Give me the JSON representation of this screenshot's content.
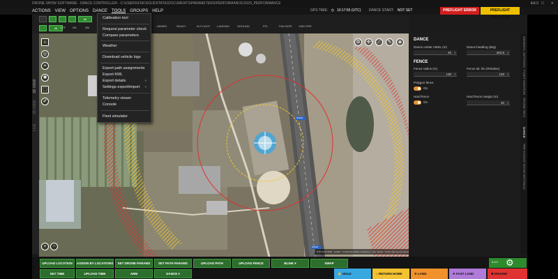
{
  "titlebar": {
    "text": "DRONE SHOW SOFTWARE   -   DANCE CONTROLLER   -   C:\\USERS\\FSK\\SOLIDSTATE\\DOCUMENTS\\PARAMETERS\\PERFORMANCE\\2020_PERFORMANCE",
    "version": "6.6.0",
    "window_controls": "—  ☐  ✕"
  },
  "menubar": {
    "items": [
      "ACTIONS",
      "VIEW",
      "OPTIONS",
      "DANCE",
      "TOOLS",
      "GROUPS",
      "HELP"
    ],
    "gps_time_label": "GPS TIME:",
    "gps_time_value": "10:17:55 (UTC)",
    "dance_start_label": "DANCE START:",
    "dance_start_value": "NOT SET",
    "preflight_error": "PREFLIGHT ERROR",
    "preflight_checklist": "PREFLIGHT CHECKLIST"
  },
  "toolbar": {
    "btn_all": "All",
    "btn_all2": "All",
    "btn_46": "46",
    "labels": [
      "OFF",
      "OK",
      "ON"
    ],
    "stat_headers": [
      "ARMED",
      "READY",
      "IN FLIGHT",
      "LANDING",
      "GROUND",
      "RTL",
      "FAILSAFE",
      "CMD ERR"
    ]
  },
  "left_tabs": [
    "3D VIEW",
    "2D VIEW",
    "LIVE"
  ],
  "tools_menu": {
    "items": [
      "Calibration tool",
      "Request parameter check",
      "Compare parameters",
      "Weather",
      "Download vehicle logs",
      "Export path assignments",
      "Export KML",
      "Export details",
      "Settings export/import",
      "Telemetry viewer",
      "Console",
      "Fleet simulator"
    ],
    "submenu_arrow": "›"
  },
  "map": {
    "attribution": "NTB 2CAP 2020 · Leaflet · © OpenStreetMap contributors · Esri, Maxar   ·   Vector data: ground elevation 35.0 m",
    "zoom_in": "+",
    "zoom_out": "−",
    "road_labels": [
      "SS106",
      "SS106"
    ]
  },
  "right_panel": {
    "dance_header": "DANCE",
    "dance_center_label": "Dance center AMSL (m)",
    "dance_center_value": "45",
    "dance_heading_label": "Dance heading (deg)",
    "dance_heading_value": "263.8",
    "fence_header": "FENCE",
    "fence_radius_label": "Fence radius (m)",
    "fence_radius_value": "130",
    "fence_alt_label": "Fence alt. lim (Relative)",
    "fence_alt_value": "120",
    "polygon_fence_label": "Polygon fence",
    "polygon_fence_state": "On",
    "hard_fence_label": "Hard fence",
    "hard_fence_state": "On",
    "hard_fence_margin_label": "Hard fence margin (m)",
    "hard_fence_margin_value": "40"
  },
  "right_tabs": [
    "GENERAL SETTINGS",
    "FLEET MONITOR",
    "DRONE INFO",
    "DANCE",
    "PRE-FLIGHT",
    "SHOW SETTINGS"
  ],
  "bottom": {
    "row1": [
      "UPLOAD LOCATION",
      "ASSIGN BY LOCATIONS",
      "SET DRONE PARAMS",
      "SET PATH PARAMS",
      "UPLOAD PATH",
      "UPLOAD FENCE",
      "BLINK",
      "SWAP"
    ],
    "row2": [
      "SET TIME",
      "UPLOAD TIME",
      "ARM",
      "DANCE"
    ],
    "commands": [
      "HOLD",
      "RETURN HOME",
      "LAND",
      "FAST LAND",
      "DISARM"
    ],
    "version_small": "6.6.0"
  },
  "colors": {
    "accent_green": "#2d6d2d",
    "error_red": "#d21e1e",
    "checklist_yellow": "#f0c000",
    "hold_blue": "#39a7e0",
    "return_yellow": "#f2c230",
    "land_orange": "#f0912c",
    "fastland_purple": "#b07ad8",
    "disarm_red": "#e03232"
  }
}
